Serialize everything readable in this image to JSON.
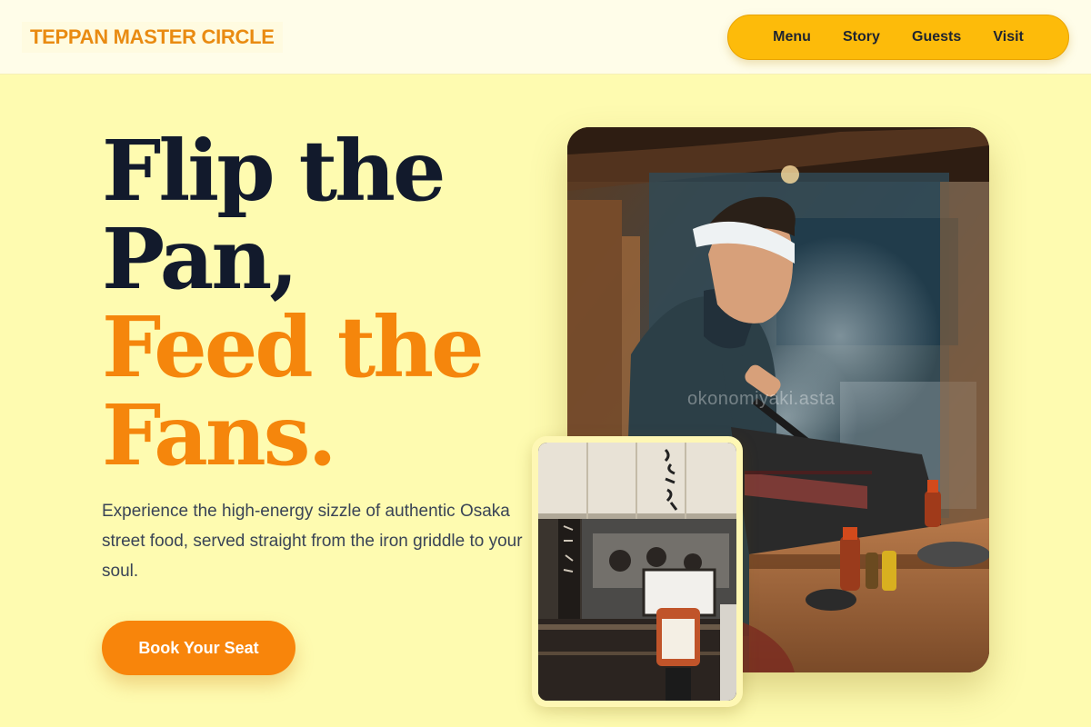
{
  "brand": {
    "name": "TEPPAN MASTER CIRCLE"
  },
  "nav": {
    "items": [
      {
        "label": "Menu"
      },
      {
        "label": "Story"
      },
      {
        "label": "Guests"
      },
      {
        "label": "Visit"
      }
    ]
  },
  "hero": {
    "title_line1": "Flip the",
    "title_line2": "Pan,",
    "title_line3": "Feed the",
    "title_line4": "Fans.",
    "description": "Experience the high-energy sizzle of authentic Osaka street food, served straight from the iron griddle to your soul.",
    "cta_label": "Book Your Seat"
  },
  "images": {
    "main_watermark": "okonomiyaki.asta"
  },
  "colors": {
    "background": "#fefbb0",
    "header_bg": "#fffde9",
    "brand_text": "#e98b12",
    "nav_bg": "#fdbb0a",
    "title_dark": "#121a2c",
    "title_accent": "#f5860c",
    "cta_bg": "#f8850b"
  }
}
